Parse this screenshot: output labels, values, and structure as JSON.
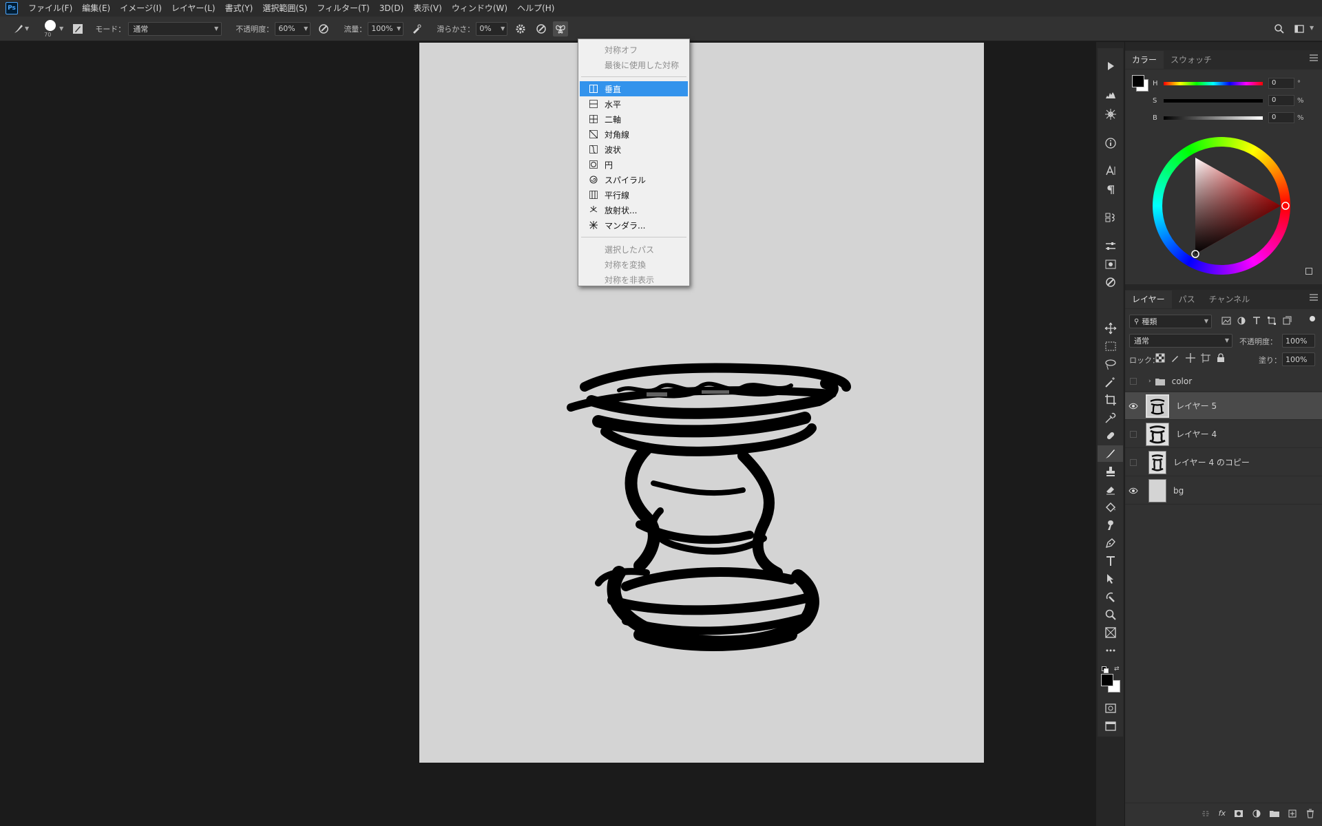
{
  "app": {
    "logo": "Ps"
  },
  "menu": [
    "ファイル(F)",
    "編集(E)",
    "イメージ(I)",
    "レイヤー(L)",
    "書式(Y)",
    "選択範囲(S)",
    "フィルター(T)",
    "3D(D)",
    "表示(V)",
    "ウィンドウ(W)",
    "ヘルプ(H)"
  ],
  "options": {
    "brush_size": "70",
    "mode_label": "モード：",
    "mode_value": "通常",
    "opacity_label": "不透明度：",
    "opacity_value": "60%",
    "flow_label": "流量：",
    "flow_value": "100%",
    "smoothing_label": "滑らかさ：",
    "smoothing_value": "0%"
  },
  "symmetry_menu": {
    "top_items": [
      "対称オフ",
      "最後に使用した対称"
    ],
    "items": [
      {
        "label": "垂直",
        "icon": "vertical-icon",
        "selected": true
      },
      {
        "label": "水平",
        "icon": "horizontal-icon"
      },
      {
        "label": "二軸",
        "icon": "dual-axis-icon"
      },
      {
        "label": "対角線",
        "icon": "diagonal-icon"
      },
      {
        "label": "波状",
        "icon": "wavy-icon"
      },
      {
        "label": "円",
        "icon": "circle-icon"
      },
      {
        "label": "スパイラル",
        "icon": "spiral-icon"
      },
      {
        "label": "平行線",
        "icon": "parallel-lines-icon"
      },
      {
        "label": "放射状...",
        "icon": "radial-icon"
      },
      {
        "label": "マンダラ...",
        "icon": "mandala-icon"
      }
    ],
    "bottom_items": [
      "選択したパス",
      "対称を変換",
      "対称を非表示"
    ]
  },
  "color_panel": {
    "tabs": [
      "カラー",
      "スウォッチ"
    ],
    "h_label": "H",
    "h_value": "0",
    "h_unit": "°",
    "s_label": "S",
    "s_value": "0",
    "s_unit": "%",
    "b_label": "B",
    "b_value": "0",
    "b_unit": "%"
  },
  "layers_panel": {
    "tabs": [
      "レイヤー",
      "パス",
      "チャンネル"
    ],
    "filter_value": "種類",
    "blend_mode": "通常",
    "opacity_label": "不透明度：",
    "opacity_value": "100%",
    "lock_label": "ロック：",
    "fill_label": "塗り：",
    "fill_value": "100%",
    "layers": [
      {
        "name": "color",
        "type": "group",
        "visible": false
      },
      {
        "name": "レイヤー 5",
        "visible": true,
        "selected": true
      },
      {
        "name": "レイヤー 4",
        "visible": false
      },
      {
        "name": "レイヤー 4 のコピー",
        "visible": false
      },
      {
        "name": "bg",
        "visible": true
      }
    ]
  },
  "colors": {
    "accent": "#3393ec",
    "panel_bg": "#323232",
    "canvas_bg": "#d4d4d4"
  }
}
